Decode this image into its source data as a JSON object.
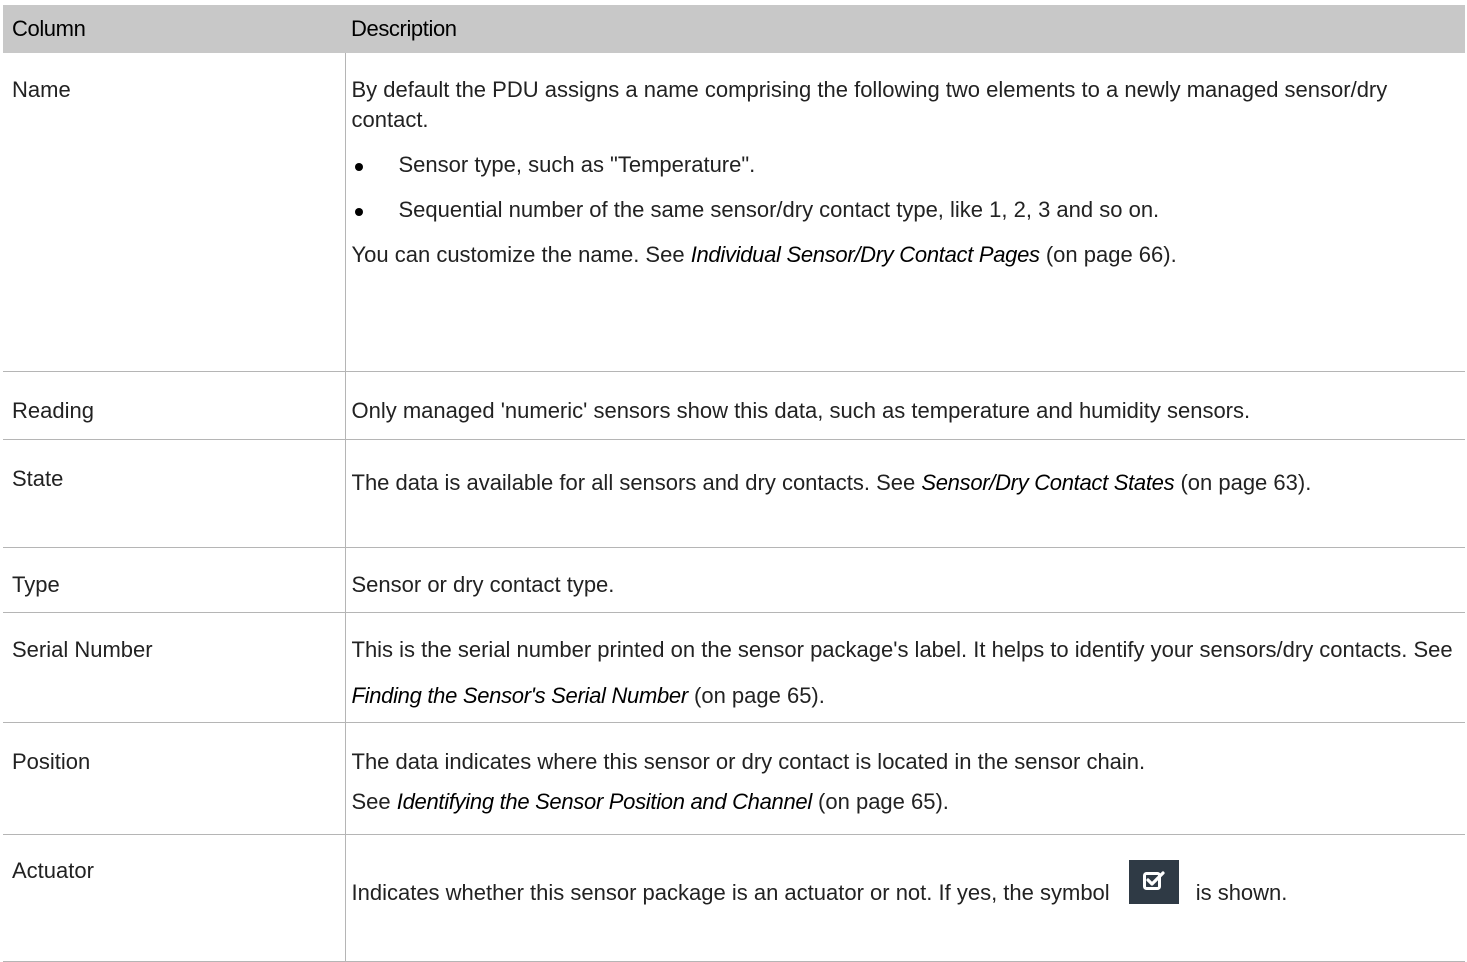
{
  "table": {
    "header": {
      "col1": "Column",
      "col2": "Description"
    },
    "rows": {
      "name": {
        "label": "Name",
        "intro": "By default the PDU assigns a name comprising the following two elements to a newly managed sensor/dry contact.",
        "bullets": [
          "Sensor type, such as \"Temperature\".",
          "Sequential number of the same sensor/dry contact type, like 1, 2, 3 and so on."
        ],
        "outro_pre": "You can customize the name. See ",
        "outro_link": "Individual Sensor/Dry Contact Pages",
        "outro_post": " (on page 66)."
      },
      "reading": {
        "label": "Reading",
        "text": "Only managed 'numeric' sensors show this data, such as temperature and humidity sensors."
      },
      "state": {
        "label": "State",
        "pre": "The data is available for all sensors and dry contacts. See ",
        "link": "Sensor/Dry Contact States",
        "post": " (on page 63)."
      },
      "type": {
        "label": "Type",
        "text": "Sensor or dry contact type."
      },
      "serial": {
        "label": "Serial Number",
        "pre": "This is the serial number printed on the sensor package's label. It helps to identify your sensors/dry contacts. See ",
        "link": "Finding the Sensor's Serial Number",
        "post": " (on page 65)."
      },
      "position": {
        "label": "Position",
        "line1": "The data indicates where this sensor or dry contact is located in the sensor chain.",
        "pre": "See ",
        "link": "Identifying the Sensor Position and Channel",
        "post": " (on page 65)."
      },
      "actuator": {
        "label": "Actuator",
        "pre": "Indicates whether this sensor package is an actuator or not. If yes, the symbol",
        "icon": "checkbox-checked-icon",
        "post": "is shown."
      }
    }
  },
  "colors": {
    "header_bg": "#c8c8c8",
    "icon_bg": "#2f3a45",
    "border": "#b5b5b5"
  }
}
